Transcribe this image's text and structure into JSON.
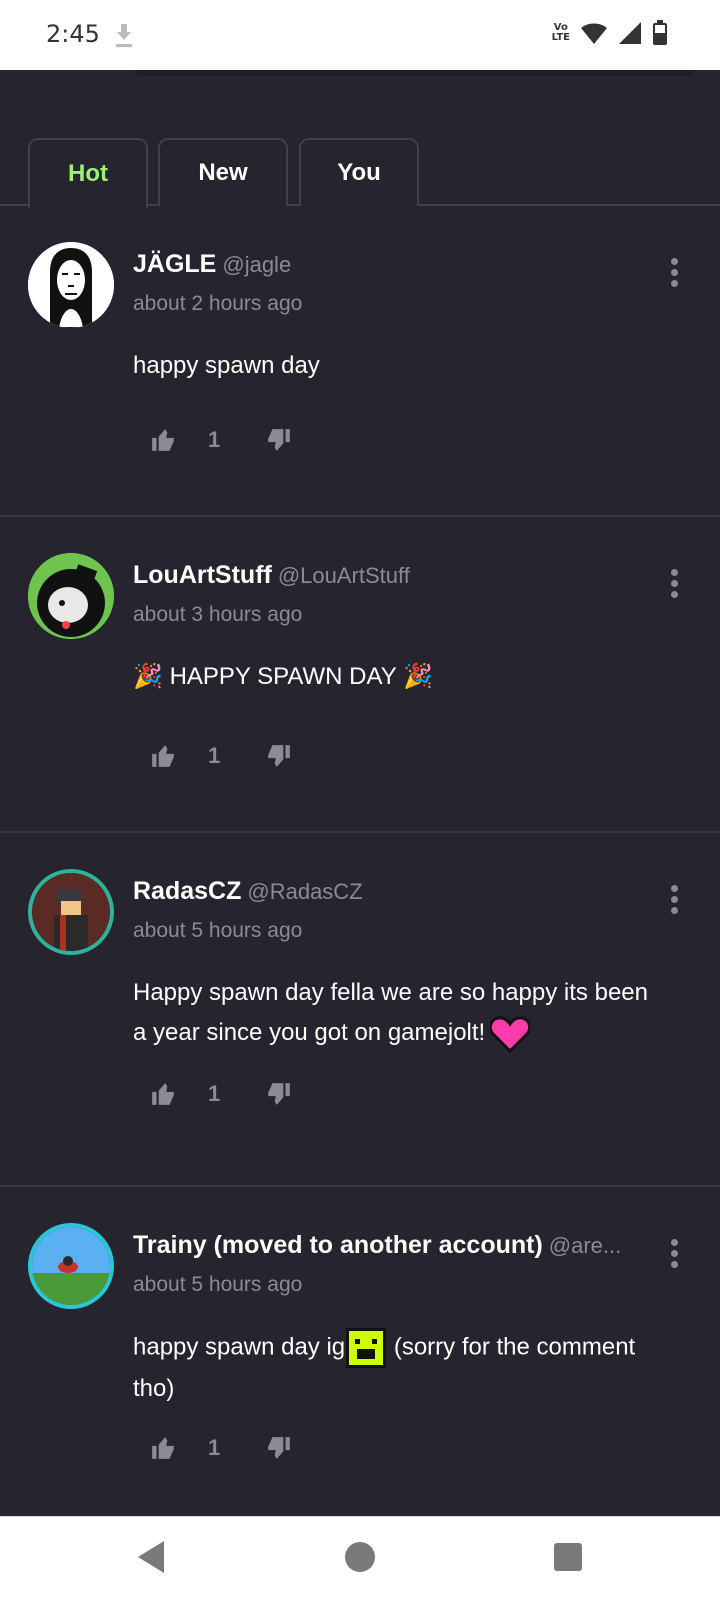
{
  "status_bar": {
    "time": "2:45",
    "volte_line1": "Vo",
    "volte_line2": "LTE"
  },
  "tabs": [
    {
      "label": "Hot",
      "active": true
    },
    {
      "label": "New",
      "active": false
    },
    {
      "label": "You",
      "active": false
    }
  ],
  "comments": [
    {
      "name": "JÄGLE",
      "handle": "@jagle",
      "time": "about 2 hours ago",
      "text": "happy spawn day",
      "likes": "1"
    },
    {
      "name": "LouArtStuff",
      "handle": "@LouArtStuff",
      "time": "about 3 hours ago",
      "text": "HAPPY SPAWN DAY",
      "emoji_left": "🎉",
      "emoji_right": "🎉",
      "likes": "1"
    },
    {
      "name": "RadasCZ",
      "handle": "@RadasCZ",
      "time": "about 5 hours ago",
      "text": "Happy spawn day fella we are so happy its been a year since you got on gamejolt!",
      "likes": "1"
    },
    {
      "name": "Trainy (moved to another account)",
      "handle": "@are...",
      "time": "about 5 hours ago",
      "text_before": "happy spawn day ig",
      "text_after": " (sorry for the comment tho)",
      "likes": "1"
    }
  ],
  "colors": {
    "accent_green": "#9ef075",
    "background": "#25242f",
    "muted": "#8c8a94",
    "heart": "#ff3cac"
  },
  "icons": [
    "download-icon",
    "wifi-icon",
    "signal-icon",
    "battery-icon",
    "more-vert-icon",
    "thumbs-up-icon",
    "thumbs-down-icon",
    "back-icon",
    "home-icon",
    "recents-icon"
  ]
}
